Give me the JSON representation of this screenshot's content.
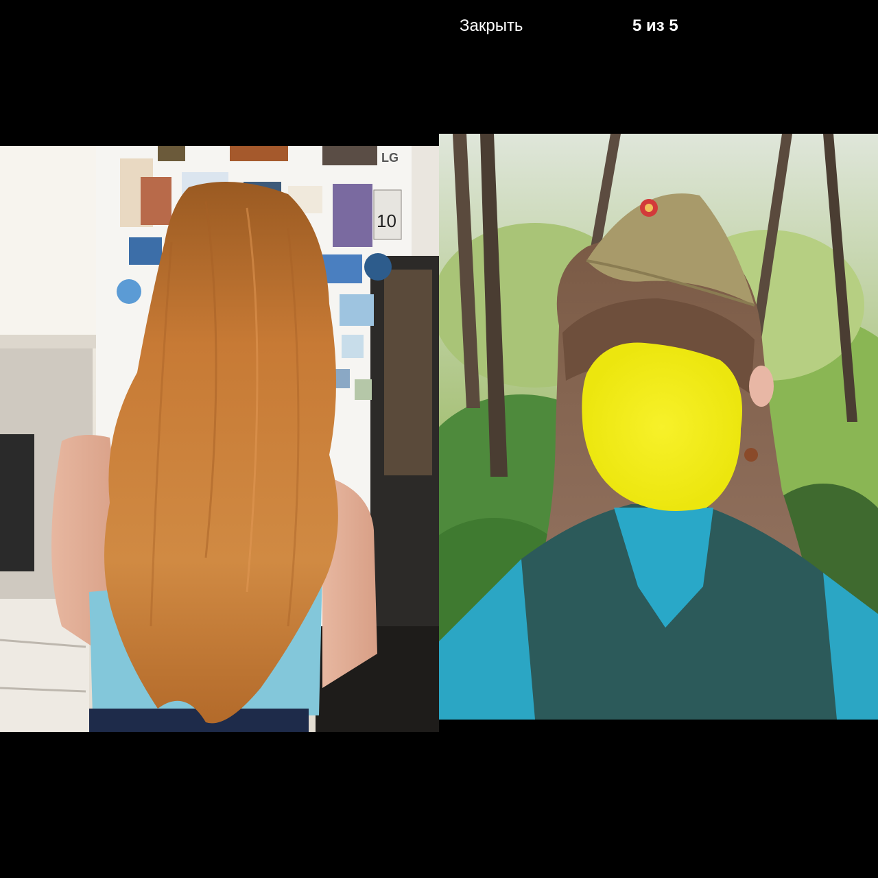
{
  "viewer": {
    "close_label": "Закрыть",
    "counter": "5 из 5"
  },
  "photos": [
    {
      "name": "before-photo",
      "subject": "woman-long-ginger-hair-back-view"
    },
    {
      "name": "after-photo",
      "subject": "woman-brown-hair-bangs-garrison-cap-face-blurred"
    }
  ],
  "refrigerator_brand": "LG",
  "magnet_number": "10",
  "colors": {
    "background": "#000000",
    "text": "#ffffff",
    "face_blur": "#f2f000"
  }
}
